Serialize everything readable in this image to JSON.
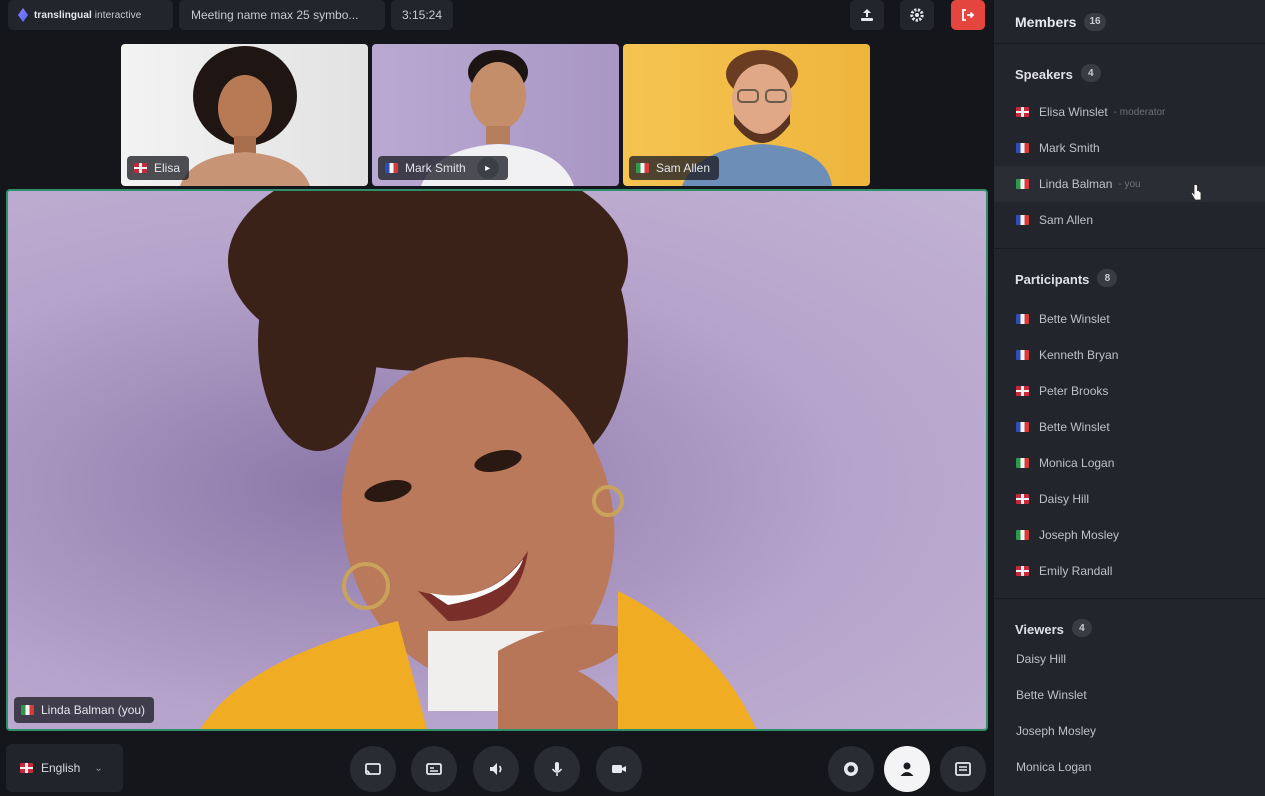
{
  "topbar": {
    "logo_brand": "translingual",
    "logo_sub": "interactive",
    "meeting_name": "Meeting name max 25 symbo...",
    "timer": "3:15:24"
  },
  "thumbnails": [
    {
      "name": "Elisa",
      "flag": "gb",
      "bg": "#ececec"
    },
    {
      "name": "Mark Smith",
      "flag": "fr",
      "bg": "#b7a6cf"
    },
    {
      "name": "Sam Allen",
      "flag": "it",
      "bg": "#f2c04a"
    }
  ],
  "stage": {
    "name": "Linda Balman (you)",
    "flag": "it",
    "active_border": "#2f8f6b"
  },
  "bottombar": {
    "language": "English",
    "language_flag": "gb"
  },
  "sidebar": {
    "title": "Members",
    "total": "16",
    "speakers": {
      "title": "Speakers",
      "count": "4",
      "items": [
        {
          "name": "Elisa Winslet",
          "role": "- moderator",
          "flag": "gb"
        },
        {
          "name": "Mark Smith",
          "role": "",
          "flag": "fr"
        },
        {
          "name": "Linda Balman",
          "role": "- you",
          "flag": "it"
        },
        {
          "name": "Sam Allen",
          "role": "",
          "flag": "fr"
        }
      ]
    },
    "participants": {
      "title": "Participants",
      "count": "8",
      "items": [
        {
          "name": "Bette Winslet",
          "flag": "fr"
        },
        {
          "name": "Kenneth Bryan",
          "flag": "fr"
        },
        {
          "name": "Peter Brooks",
          "flag": "gb"
        },
        {
          "name": "Bette Winslet",
          "flag": "fr"
        },
        {
          "name": "Monica Logan",
          "flag": "it"
        },
        {
          "name": "Daisy Hill",
          "flag": "gb"
        },
        {
          "name": "Joseph Mosley",
          "flag": "it"
        },
        {
          "name": "Emily Randall",
          "flag": "gb"
        }
      ]
    },
    "viewers": {
      "title": "Viewers",
      "count": "4",
      "items": [
        "Daisy Hill",
        "Bette Winslet",
        "Joseph Mosley",
        "Monica Logan"
      ]
    }
  },
  "colors": {
    "leave": "#e4463f",
    "background": "#15161c",
    "sidebar": "#23252c"
  }
}
